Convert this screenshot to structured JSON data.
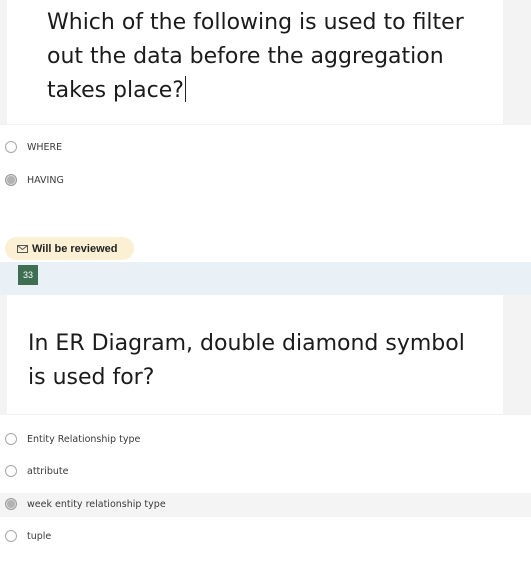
{
  "question1": {
    "text_line1": "Which of the following is used to filter",
    "text_line2": "out the data before the aggregation",
    "text_line3": "takes place?",
    "options": [
      {
        "label": "WHERE",
        "selected": false
      },
      {
        "label": "HAVING",
        "selected": true
      }
    ]
  },
  "review": {
    "icon": "envelope-icon",
    "label": "Will be reviewed"
  },
  "question2": {
    "number": "33",
    "text_line1": "In ER Diagram, double diamond symbol",
    "text_line2": "is used for?",
    "options": [
      {
        "label": "Entity Relationship type",
        "selected": false
      },
      {
        "label": "attribute",
        "selected": false
      },
      {
        "label": "week entity relationship type",
        "selected": true
      },
      {
        "label": "tuple",
        "selected": false
      }
    ]
  },
  "colors": {
    "page_bg": "#f2f2f2",
    "card_bg": "#ffffff",
    "review_bg": "#fbf0d4",
    "badge_bg": "#3f6f52",
    "number_band": "#e9f1f6"
  }
}
